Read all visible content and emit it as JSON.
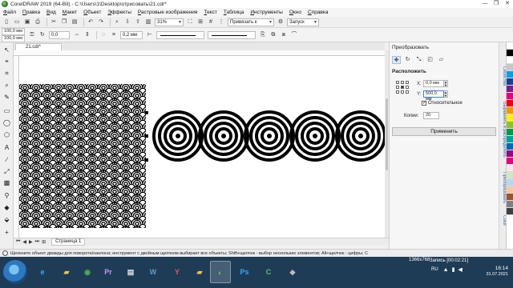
{
  "window": {
    "title": "CorelDRAW 2019 (64-Bit) - C:\\Users\\1\\Desktop\\отрисовать\\21.cdr*",
    "minimize": "—",
    "restore": "❐",
    "close": "✕"
  },
  "menu": [
    "Файл",
    "Правка",
    "Вид",
    "Макет",
    "Объект",
    "Эффекты",
    "Растровые изображения",
    "Текст",
    "Таблица",
    "Инструменты",
    "Окно",
    "Справка"
  ],
  "toolbar": {
    "zoom": "31%",
    "snap_label": "Привязать к",
    "launch_label": "Запуск"
  },
  "propbar": {
    "width": "100,0 мм",
    "height": "100,0 мм",
    "angle": "0,0",
    "outline": "0,2 мм"
  },
  "document": {
    "tab_label": "21.cdr*",
    "page_label": "Страница 1"
  },
  "docker": {
    "title": "Преобразовать",
    "section": "Расположить",
    "x_label": "X:",
    "x_value": "0,0 мм",
    "y_label": "Y:",
    "y_value": "500,0 мм",
    "relative_label": "Относительное",
    "relative_checked": true,
    "copies_label": "Копии:",
    "copies_value": "20",
    "apply_label": "Применить"
  },
  "side_tabs": [
    "Свойства",
    "Выравнять и распределить",
    "Преобразовать",
    "Color"
  ],
  "palette": [
    "#ffffff",
    "#000000",
    "#ffffff",
    "#c8c8c8",
    "#00a0e9",
    "#1c3f94",
    "#7c1f8b",
    "#e4007f",
    "#e60012",
    "#f39800",
    "#fff100",
    "#8fc31f",
    "#009944",
    "#00a29a",
    "#0068b7",
    "#920783",
    "#e4007f",
    "#ffe5ec",
    "#d0e8c0",
    "#b4d8f0",
    "#f2c9a0",
    "#a0522d",
    "#808080",
    "#404040"
  ],
  "status_message": "Щелкните объект дважды для поворота/наклона; инструмент с двойным щелчком выбирает все объекты; Shift+щелчок - выбор нескольких элементов; Alt+щелчок - цифры; С",
  "canvas": {
    "pattern_fill": "#000000",
    "ring_count": 5
  },
  "taskbar": {
    "apps": [
      "IE",
      "Explorer",
      "Chrome",
      "Premiere",
      "Photos",
      "Word",
      "Yandex",
      "Explorer2",
      "CorelDRAW",
      "Ps",
      "Camtasia",
      "Other"
    ],
    "recording": "Запись [00:02:21]",
    "resolution": "1366x768",
    "lang": "RU",
    "time": "16:14",
    "date": "31.07.2021"
  }
}
